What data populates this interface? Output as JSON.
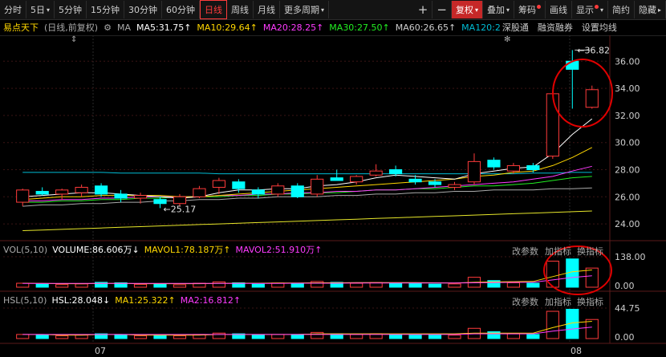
{
  "toolbar": {
    "items": [
      {
        "label": "分时"
      },
      {
        "label": "5日",
        "caret": true
      },
      {
        "label": "5分钟"
      },
      {
        "label": "15分钟"
      },
      {
        "label": "30分钟"
      },
      {
        "label": "60分钟"
      },
      {
        "label": "日线",
        "active": true
      },
      {
        "label": "周线"
      },
      {
        "label": "月线"
      },
      {
        "label": "更多周期",
        "caret": true
      }
    ],
    "plus": "+",
    "minus": "−",
    "right": [
      {
        "label": "复权",
        "caret": true,
        "red": true
      },
      {
        "label": "叠加",
        "caret": true
      },
      {
        "label": "筹码",
        "dot": true
      },
      {
        "label": "画线"
      },
      {
        "label": "显示",
        "caret": true,
        "dot": true
      },
      {
        "label": "简约"
      },
      {
        "label": "隐藏",
        "more": "▸"
      }
    ]
  },
  "ma_line": {
    "name": "易点天下",
    "mode": "(日线,前复权)",
    "icon": "gear-icon",
    "ma": "MA",
    "ma5": "MA5:31.75↑",
    "ma10": "MA10:29.64↑",
    "ma20": "MA20:28.25↑",
    "ma30": "MA30:27.50↑",
    "ma60": "MA60:26.65↑",
    "ma120": "MA120:2",
    "links": [
      "深股通",
      "融资融券",
      "设置均线"
    ]
  },
  "colors": {
    "up": "#ff3b3b",
    "down": "#00ffff",
    "ma5": "#ffffff",
    "ma10": "#ffd700",
    "ma20": "#ff3bff",
    "ma30": "#22ee22",
    "ma60": "#aaaaaa",
    "ma120": "#00bcd4",
    "ma250": "#e6e62a",
    "circle": "#e00000"
  },
  "price_axis": [
    "36.00",
    "34.00",
    "32.00",
    "30.00",
    "28.00",
    "26.00",
    "24.00"
  ],
  "annotations": {
    "high": "36.82",
    "low": "25.17"
  },
  "vol": {
    "label": "VOL(5,10)",
    "volume": "VOLUME:86.606万↓",
    "mavol1": "MAVOL1:78.187万↑",
    "mavol2": "MAVOL2:51.910万↑",
    "axis_top": "138.00",
    "axis_bottom": "0.00",
    "btns": [
      "改参数",
      "加指标",
      "换指标"
    ]
  },
  "hsl": {
    "label": "HSL(5,10)",
    "hsl": "HSL:28.048↓",
    "ma1": "MA1:25.322↑",
    "ma2": "MA2:16.812↑",
    "axis_top": "44.75",
    "axis_bottom": "0.00",
    "btns": [
      "改参数",
      "加指标",
      "换指标"
    ]
  },
  "x_labels": [
    "07",
    "08"
  ],
  "chart_data": {
    "type": "candlestick",
    "ylim": [
      23,
      37.2
    ],
    "candles": [
      {
        "o": 25.6,
        "h": 26.6,
        "l": 25.3,
        "c": 26.5,
        "v": 18,
        "hsl": 6
      },
      {
        "o": 26.4,
        "h": 26.7,
        "l": 26.1,
        "c": 26.2,
        "v": 14,
        "hsl": 5
      },
      {
        "o": 26.2,
        "h": 26.6,
        "l": 25.8,
        "c": 26.5,
        "v": 12,
        "hsl": 4
      },
      {
        "o": 26.3,
        "h": 26.9,
        "l": 26.0,
        "c": 26.7,
        "v": 15,
        "hsl": 5
      },
      {
        "o": 26.8,
        "h": 27.0,
        "l": 26.0,
        "c": 26.2,
        "v": 22,
        "hsl": 7
      },
      {
        "o": 26.2,
        "h": 26.5,
        "l": 25.6,
        "c": 25.9,
        "v": 20,
        "hsl": 6
      },
      {
        "o": 25.9,
        "h": 26.3,
        "l": 25.5,
        "c": 26.1,
        "v": 13,
        "hsl": 4
      },
      {
        "o": 25.8,
        "h": 26.0,
        "l": 25.17,
        "c": 25.5,
        "v": 16,
        "hsl": 5
      },
      {
        "o": 25.5,
        "h": 26.2,
        "l": 25.3,
        "c": 26.0,
        "v": 11,
        "hsl": 4
      },
      {
        "o": 26.0,
        "h": 26.8,
        "l": 25.9,
        "c": 26.6,
        "v": 18,
        "hsl": 6
      },
      {
        "o": 26.7,
        "h": 27.4,
        "l": 26.2,
        "c": 27.2,
        "v": 24,
        "hsl": 8
      },
      {
        "o": 27.1,
        "h": 27.3,
        "l": 26.3,
        "c": 26.6,
        "v": 20,
        "hsl": 7
      },
      {
        "o": 26.5,
        "h": 26.7,
        "l": 25.9,
        "c": 26.2,
        "v": 14,
        "hsl": 5
      },
      {
        "o": 26.2,
        "h": 27.0,
        "l": 26.0,
        "c": 26.8,
        "v": 19,
        "hsl": 6
      },
      {
        "o": 26.8,
        "h": 27.0,
        "l": 25.9,
        "c": 26.0,
        "v": 17,
        "hsl": 6
      },
      {
        "o": 26.2,
        "h": 27.6,
        "l": 26.0,
        "c": 27.3,
        "v": 26,
        "hsl": 9
      },
      {
        "o": 27.4,
        "h": 28.0,
        "l": 27.2,
        "c": 27.2,
        "v": 22,
        "hsl": 7
      },
      {
        "o": 27.1,
        "h": 27.6,
        "l": 26.9,
        "c": 27.5,
        "v": 18,
        "hsl": 6
      },
      {
        "o": 27.6,
        "h": 28.4,
        "l": 27.5,
        "c": 27.9,
        "v": 21,
        "hsl": 7
      },
      {
        "o": 28.0,
        "h": 28.3,
        "l": 27.5,
        "c": 27.7,
        "v": 19,
        "hsl": 6
      },
      {
        "o": 27.3,
        "h": 27.6,
        "l": 26.9,
        "c": 27.1,
        "v": 16,
        "hsl": 5
      },
      {
        "o": 27.1,
        "h": 27.3,
        "l": 26.7,
        "c": 26.9,
        "v": 14,
        "hsl": 5
      },
      {
        "o": 26.7,
        "h": 27.1,
        "l": 26.5,
        "c": 26.9,
        "v": 15,
        "hsl": 5
      },
      {
        "o": 27.1,
        "h": 29.2,
        "l": 26.9,
        "c": 28.6,
        "v": 45,
        "hsl": 15
      },
      {
        "o": 28.7,
        "h": 28.9,
        "l": 28.0,
        "c": 28.2,
        "v": 30,
        "hsl": 10
      },
      {
        "o": 27.9,
        "h": 28.5,
        "l": 27.7,
        "c": 28.3,
        "v": 20,
        "hsl": 7
      },
      {
        "o": 28.3,
        "h": 28.5,
        "l": 27.8,
        "c": 28.0,
        "v": 18,
        "hsl": 6
      },
      {
        "o": 29.0,
        "h": 33.8,
        "l": 28.8,
        "c": 33.6,
        "v": 118,
        "hsl": 40
      },
      {
        "o": 36.0,
        "h": 36.82,
        "l": 32.5,
        "c": 35.4,
        "v": 128,
        "hsl": 43
      },
      {
        "o": 32.6,
        "h": 34.2,
        "l": 32.5,
        "c": 33.9,
        "v": 86.6,
        "hsl": 28
      }
    ],
    "down_override": [
      1,
      4,
      5,
      7,
      11,
      12,
      14,
      16,
      19,
      20,
      21,
      24,
      26,
      28
    ],
    "ma5": [
      26.0,
      26.1,
      26.2,
      26.3,
      26.3,
      26.2,
      26.1,
      26.0,
      25.9,
      26.0,
      26.3,
      26.5,
      26.5,
      26.6,
      26.6,
      26.8,
      26.9,
      27.1,
      27.4,
      27.6,
      27.5,
      27.4,
      27.3,
      27.7,
      27.9,
      28.1,
      28.2,
      29.2,
      30.6,
      31.75
    ],
    "ma10": [
      25.8,
      25.9,
      26.0,
      26.0,
      26.1,
      26.1,
      26.1,
      26.1,
      26.0,
      26.0,
      26.1,
      26.2,
      26.3,
      26.4,
      26.5,
      26.6,
      26.7,
      26.8,
      26.9,
      27.0,
      27.1,
      27.2,
      27.3,
      27.5,
      27.6,
      27.8,
      27.9,
      28.3,
      28.9,
      29.64
    ],
    "ma20": [
      25.7,
      25.7,
      25.8,
      25.8,
      25.9,
      25.9,
      26.0,
      26.0,
      26.0,
      26.0,
      26.1,
      26.1,
      26.2,
      26.2,
      26.3,
      26.3,
      26.4,
      26.4,
      26.5,
      26.5,
      26.6,
      26.7,
      26.8,
      26.9,
      27.0,
      27.1,
      27.3,
      27.5,
      27.9,
      28.25
    ],
    "ma30": [
      25.6,
      25.6,
      25.7,
      25.7,
      25.8,
      25.8,
      25.9,
      25.9,
      26.0,
      26.0,
      26.0,
      26.1,
      26.1,
      26.2,
      26.2,
      26.3,
      26.3,
      26.4,
      26.5,
      26.5,
      26.6,
      26.6,
      26.7,
      26.8,
      26.8,
      26.9,
      27.0,
      27.2,
      27.4,
      27.5
    ],
    "ma60": [
      25.3,
      25.4,
      25.4,
      25.5,
      25.5,
      25.6,
      25.6,
      25.7,
      25.7,
      25.8,
      25.8,
      25.9,
      25.9,
      26.0,
      26.0,
      26.0,
      26.1,
      26.1,
      26.2,
      26.2,
      26.3,
      26.3,
      26.4,
      26.4,
      26.5,
      26.5,
      26.5,
      26.6,
      26.6,
      26.65
    ],
    "ma120": [
      27.8,
      27.8,
      27.8,
      27.8,
      27.8,
      27.75,
      27.75,
      27.75,
      27.75,
      27.75,
      27.7,
      27.7,
      27.7,
      27.7,
      27.7,
      27.7,
      27.7,
      27.7,
      27.7,
      27.7,
      27.7,
      27.7,
      27.7,
      27.7,
      27.7,
      27.7,
      27.75,
      27.75,
      27.8,
      27.8
    ],
    "ma250": [
      23.5,
      23.55,
      23.6,
      23.65,
      23.7,
      23.75,
      23.8,
      23.85,
      23.9,
      23.95,
      24.0,
      24.05,
      24.1,
      24.15,
      24.2,
      24.25,
      24.3,
      24.35,
      24.4,
      24.45,
      24.5,
      24.55,
      24.6,
      24.65,
      24.7,
      24.75,
      24.8,
      24.85,
      24.9,
      24.95
    ],
    "mavol1": [
      18,
      17,
      16,
      16,
      17,
      17,
      16,
      16,
      16,
      16,
      17,
      18,
      18,
      19,
      19,
      20,
      20,
      21,
      21,
      21,
      21,
      20,
      19,
      22,
      24,
      25,
      26,
      48,
      70,
      78.187
    ],
    "mavol2": [
      17,
      17,
      17,
      17,
      17,
      17,
      17,
      17,
      17,
      17,
      17,
      17,
      17,
      17,
      18,
      18,
      18,
      19,
      19,
      19,
      19,
      19,
      19,
      20,
      21,
      22,
      22,
      33,
      44,
      51.91
    ],
    "hsl_ma1": [
      6,
      6,
      5,
      5,
      6,
      6,
      5,
      5,
      5,
      5,
      6,
      6,
      6,
      6,
      6,
      7,
      7,
      7,
      7,
      7,
      7,
      7,
      7,
      8,
      8,
      8,
      8,
      16,
      23,
      25.322
    ],
    "hsl_ma2": [
      6,
      6,
      6,
      6,
      6,
      6,
      6,
      6,
      6,
      6,
      6,
      6,
      6,
      6,
      6,
      6,
      6,
      6,
      6,
      6,
      6,
      6,
      6,
      7,
      7,
      7,
      7,
      11,
      14,
      16.812
    ]
  }
}
